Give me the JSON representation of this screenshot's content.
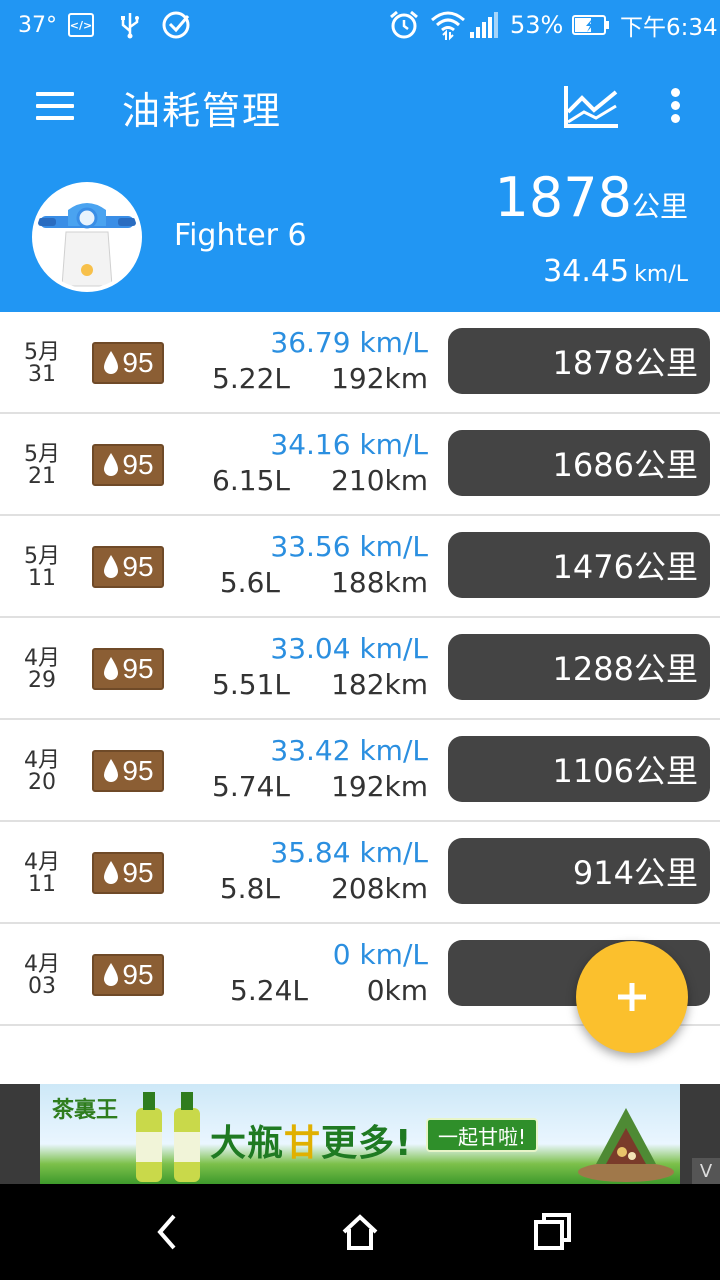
{
  "status_bar": {
    "temperature": "37°",
    "battery": "53%",
    "time": "下午6:34",
    "icons": [
      "code-icon",
      "usb-icon",
      "notification-icon",
      "alarm-icon",
      "wifi-icon",
      "signal-icon",
      "battery-icon"
    ]
  },
  "app_bar": {
    "title": "油耗管理",
    "icons": [
      "menu-icon",
      "chart-icon",
      "more-icon"
    ]
  },
  "summary": {
    "vehicle_name": "Fighter 6",
    "total_distance": "1878",
    "total_distance_unit": "公里",
    "avg_efficiency": "34.45",
    "avg_efficiency_unit": "km/L"
  },
  "records": [
    {
      "month": "5月",
      "day": "31",
      "fuel_grade": "95",
      "efficiency": "36.79 km/L",
      "liters": "5.22L",
      "distance": "192km",
      "odometer": "1878公里"
    },
    {
      "month": "5月",
      "day": "21",
      "fuel_grade": "95",
      "efficiency": "34.16 km/L",
      "liters": "6.15L",
      "distance": "210km",
      "odometer": "1686公里"
    },
    {
      "month": "5月",
      "day": "11",
      "fuel_grade": "95",
      "efficiency": "33.56 km/L",
      "liters": "5.6L",
      "distance": "188km",
      "odometer": "1476公里"
    },
    {
      "month": "4月",
      "day": "29",
      "fuel_grade": "95",
      "efficiency": "33.04 km/L",
      "liters": "5.51L",
      "distance": "182km",
      "odometer": "1288公里"
    },
    {
      "month": "4月",
      "day": "20",
      "fuel_grade": "95",
      "efficiency": "33.42 km/L",
      "liters": "5.74L",
      "distance": "192km",
      "odometer": "1106公里"
    },
    {
      "month": "4月",
      "day": "11",
      "fuel_grade": "95",
      "efficiency": "35.84 km/L",
      "liters": "5.8L",
      "distance": "208km",
      "odometer": "914公里"
    },
    {
      "month": "4月",
      "day": "03",
      "fuel_grade": "95",
      "efficiency": "0 km/L",
      "liters": "5.24L",
      "distance": "0km",
      "odometer": ""
    }
  ],
  "ad": {
    "brand": "茶裏王",
    "slogan_pre": "大瓶",
    "slogan_highlight": "甘",
    "slogan_post": "更多!",
    "cta": "一起甘啦!",
    "close": "V"
  },
  "colors": {
    "primary": "#2196f3",
    "efficiency_text": "#2b8fe0",
    "fuel_badge": "#8b5e34",
    "odometer_pill": "#444444",
    "fab": "#fbc02d"
  }
}
